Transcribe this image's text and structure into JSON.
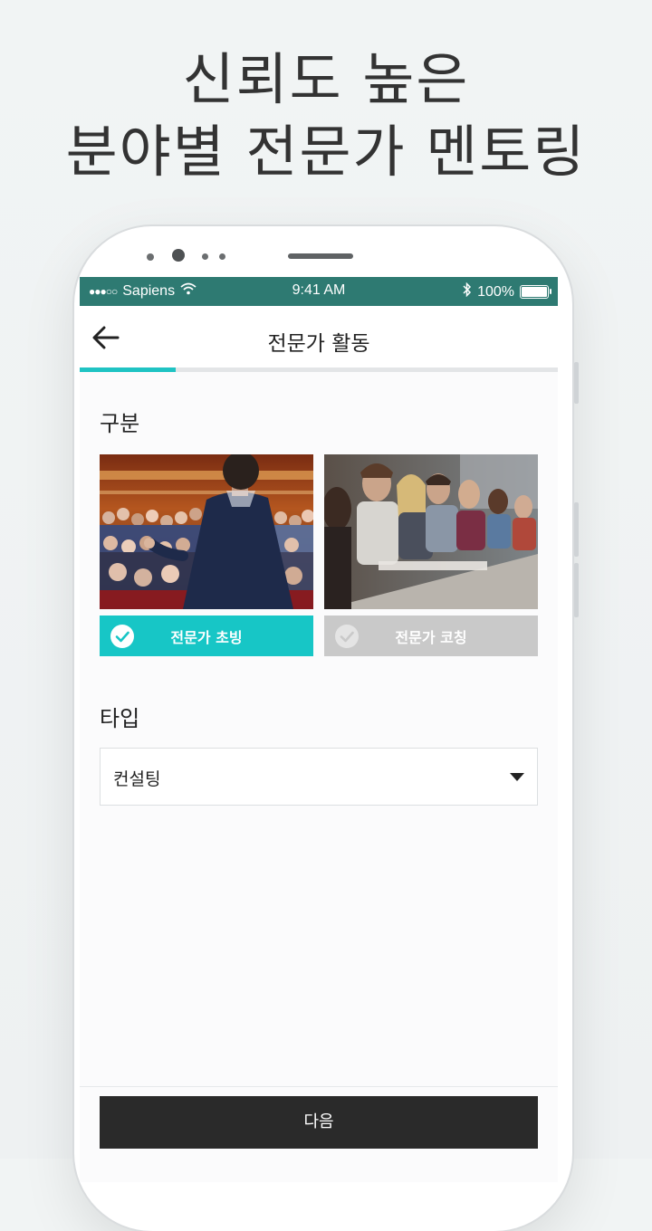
{
  "headline": {
    "line1": "신뢰도 높은",
    "line2": "분야별 전문가 멘토링"
  },
  "status_bar": {
    "signal": "●●●○○",
    "carrier": "Sapiens",
    "time": "9:41 AM",
    "battery": "100%",
    "bluetooth_icon": "bluetooth-icon",
    "wifi_icon": "wifi-icon"
  },
  "nav": {
    "title": "전문가 활동",
    "back_icon": "arrow-left-icon"
  },
  "progress": {
    "fraction": 0.2,
    "color": "#1fc3c3"
  },
  "section_category": {
    "label": "구분",
    "options": [
      {
        "label": "전문가 초빙",
        "selected": true,
        "color": "#17c6c6"
      },
      {
        "label": "전문가 코칭",
        "selected": false,
        "color": "#c9c9c9"
      }
    ]
  },
  "section_type": {
    "label": "타입",
    "select_value": "컨설팅",
    "caret_icon": "caret-down-icon"
  },
  "footer": {
    "next_label": "다음"
  },
  "colors": {
    "status_bar": "#2e7a72",
    "accent": "#17c6c6",
    "unselected": "#c9c9c9",
    "button": "#2a2a2a"
  }
}
